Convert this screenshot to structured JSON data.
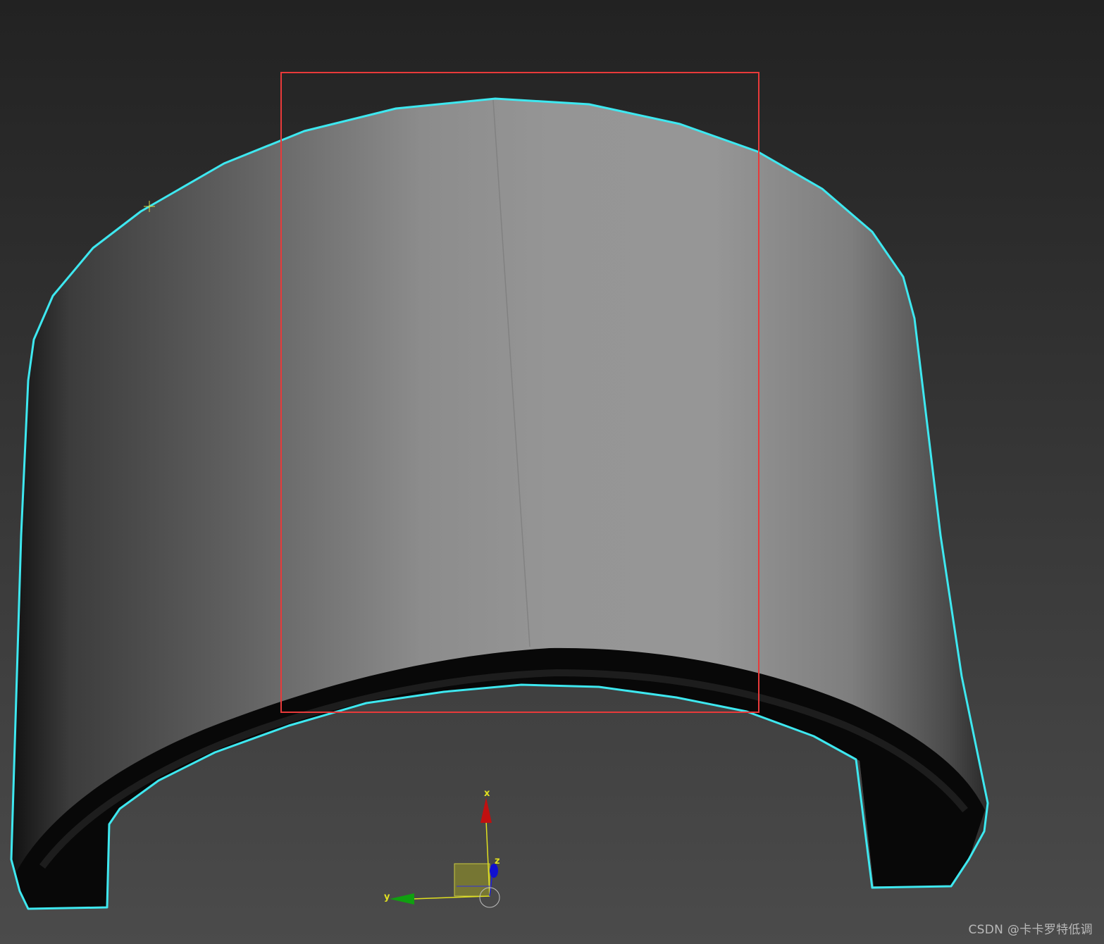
{
  "viewport": {
    "background_top": "#232323",
    "background_bottom": "#4a4a4a"
  },
  "object": {
    "type": "curved wall / half cylinder shell",
    "outline_color": "#3ee8f0",
    "surface_light": "#9a9a9a",
    "surface_dark": "#1a1a1a"
  },
  "selection": {
    "color": "#e83a3a"
  },
  "gizmo": {
    "x_label": "x",
    "y_label": "y",
    "z_label": "z",
    "x_color": "#c01010",
    "y_color": "#10a010",
    "z_color": "#1010d0",
    "axis_line_color": "#e0e020",
    "plane_color": "#8a8a30"
  },
  "watermark": "CSDN @卡卡罗特低调"
}
